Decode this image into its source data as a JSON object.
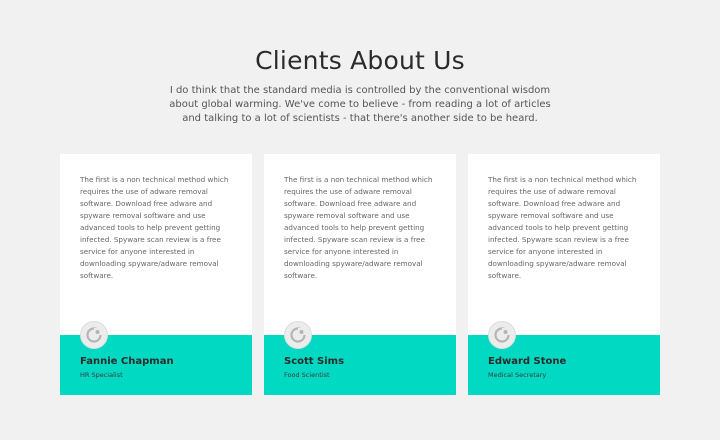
{
  "section": {
    "title": "Clients About Us",
    "intro": "I do think that the standard media is controlled by the conventional wisdom about global warming. We've come to believe - from reading a lot of articles and talking to a lot of scientists - that there's another side to be heard."
  },
  "testimonials": [
    {
      "text": "The first is a non technical method which requires the use of adware removal software. Download free adware and spyware removal software and use advanced tools to help prevent getting infected. Spyware scan review is a free service for anyone interested in downloading spyware/adware removal software.",
      "name": "Fannie Chapman",
      "role": "HR Specialist",
      "avatar_icon": "user-avatar-icon"
    },
    {
      "text": "The first is a non technical method which requires the use of adware removal software. Download free adware and spyware removal software and use advanced tools to help prevent getting infected. Spyware scan review is a free service for anyone interested in downloading spyware/adware removal software.",
      "name": "Scott Sims",
      "role": "Food Scientist",
      "avatar_icon": "user-avatar-icon"
    },
    {
      "text": "The first is a non technical method which requires the use of adware removal software. Download free adware and spyware removal software and use advanced tools to help prevent getting infected. Spyware scan review is a free service for anyone interested in downloading spyware/adware removal software.",
      "name": "Edward Stone",
      "role": "Medical Secretary",
      "avatar_icon": "user-avatar-icon"
    }
  ],
  "colors": {
    "background": "#f1f1f1",
    "card": "#ffffff",
    "accent": "#02d9c2",
    "text": "#2b2b2b"
  }
}
